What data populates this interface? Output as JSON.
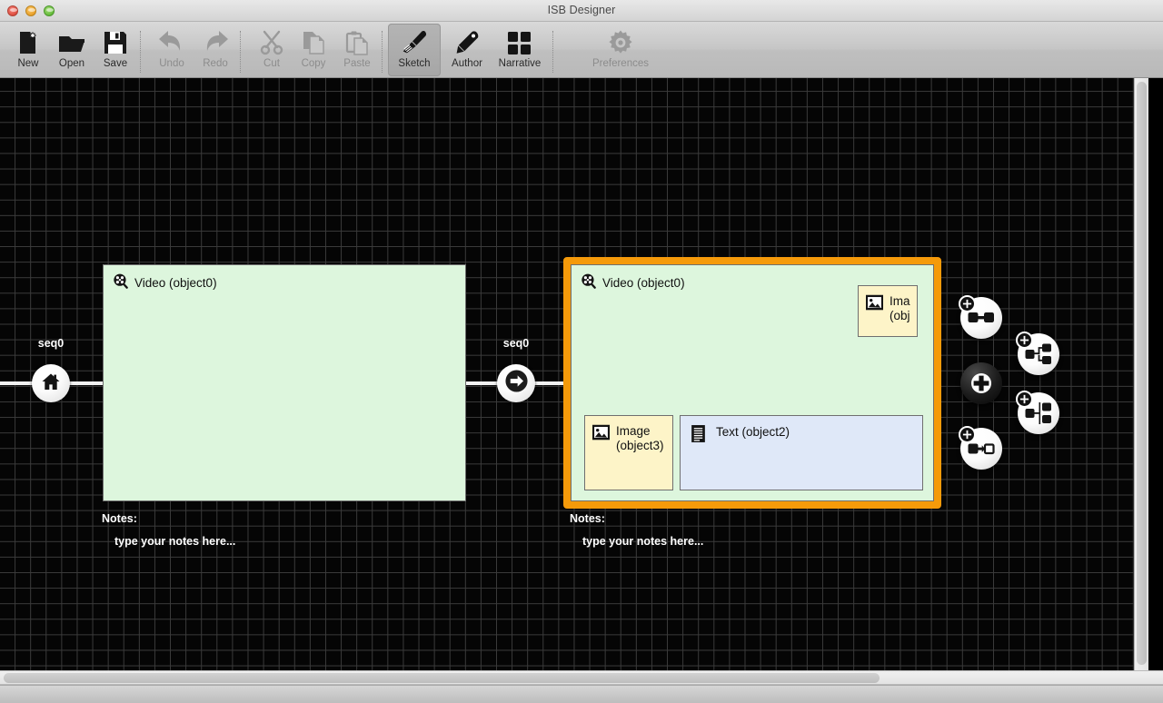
{
  "window": {
    "title": "ISB Designer",
    "controls": [
      {
        "name": "close",
        "color": "#dd4b3c"
      },
      {
        "name": "minimize",
        "color": "#e9a029"
      },
      {
        "name": "maximize",
        "color": "#63bb39"
      }
    ]
  },
  "toolbar": {
    "items": [
      {
        "id": "new",
        "label": "New",
        "icon": "new-document-icon",
        "state": "enabled"
      },
      {
        "id": "open",
        "label": "Open",
        "icon": "folder-open-icon",
        "state": "enabled"
      },
      {
        "id": "save",
        "label": "Save",
        "icon": "floppy-disk-icon",
        "state": "enabled"
      },
      {
        "id": "undo",
        "label": "Undo",
        "icon": "undo-arrow-icon",
        "state": "disabled"
      },
      {
        "id": "redo",
        "label": "Redo",
        "icon": "redo-arrow-icon",
        "state": "disabled"
      },
      {
        "id": "cut",
        "label": "Cut",
        "icon": "scissors-icon",
        "state": "disabled"
      },
      {
        "id": "copy",
        "label": "Copy",
        "icon": "copy-pages-icon",
        "state": "disabled"
      },
      {
        "id": "paste",
        "label": "Paste",
        "icon": "clipboard-icon",
        "state": "disabled"
      },
      {
        "id": "sketch",
        "label": "Sketch",
        "icon": "paintbrush-icon",
        "state": "selected"
      },
      {
        "id": "author",
        "label": "Author",
        "icon": "pencil-icon",
        "state": "enabled"
      },
      {
        "id": "narrative",
        "label": "Narrative",
        "icon": "grid-squares-icon",
        "state": "enabled"
      },
      {
        "id": "preferences",
        "label": "Preferences",
        "icon": "gear-icon",
        "state": "disabled"
      }
    ]
  },
  "canvas": {
    "background_color": "#050505",
    "grid_color": "#3b3b3b",
    "selection_color": "#f59a0a",
    "scene_color": "#ddf6dd",
    "image_object_color": "#fdf4c8",
    "text_object_color": "#dfe8f8",
    "sequences": [
      {
        "id": "seq-start",
        "label": "seq0",
        "icon": "home-icon"
      },
      {
        "id": "seq-next",
        "label": "seq0",
        "icon": "arrow-right-circle-icon"
      }
    ],
    "scenes": [
      {
        "id": "scene-1",
        "title": "Video (object0)",
        "title_icon": "film-reel-icon",
        "selected": false,
        "notes_label": "Notes:",
        "notes_text": "type your notes here...",
        "children": []
      },
      {
        "id": "scene-2",
        "title": "Video (object0)",
        "title_icon": "film-reel-icon",
        "selected": true,
        "notes_label": "Notes:",
        "notes_text": "type your notes here...",
        "children": [
          {
            "id": "obj1",
            "label": "Ima\n(obj",
            "kind": "image",
            "icon": "picture-icon",
            "truncated": true
          },
          {
            "id": "obj3",
            "label": "Image\n(object3)",
            "kind": "image",
            "icon": "picture-icon",
            "truncated": false
          },
          {
            "id": "obj2",
            "label": "Text (object2)",
            "kind": "text",
            "icon": "document-lines-icon",
            "truncated": false
          }
        ]
      }
    ],
    "add_buttons": [
      {
        "id": "add-linked-pair",
        "icon": "add-linked-nodes-icon",
        "style": "light"
      },
      {
        "id": "add-branch-right",
        "icon": "add-branch-icon",
        "style": "light"
      },
      {
        "id": "add-object",
        "icon": "plus-circle-icon",
        "style": "dark"
      },
      {
        "id": "add-branch-split",
        "icon": "add-branch-split-icon",
        "style": "light"
      },
      {
        "id": "add-transition",
        "icon": "add-transition-icon",
        "style": "light"
      }
    ]
  },
  "scrollbars": {
    "horizontal": {
      "name": "horizontal-scrollbar"
    },
    "vertical": {
      "name": "vertical-scrollbar"
    }
  }
}
